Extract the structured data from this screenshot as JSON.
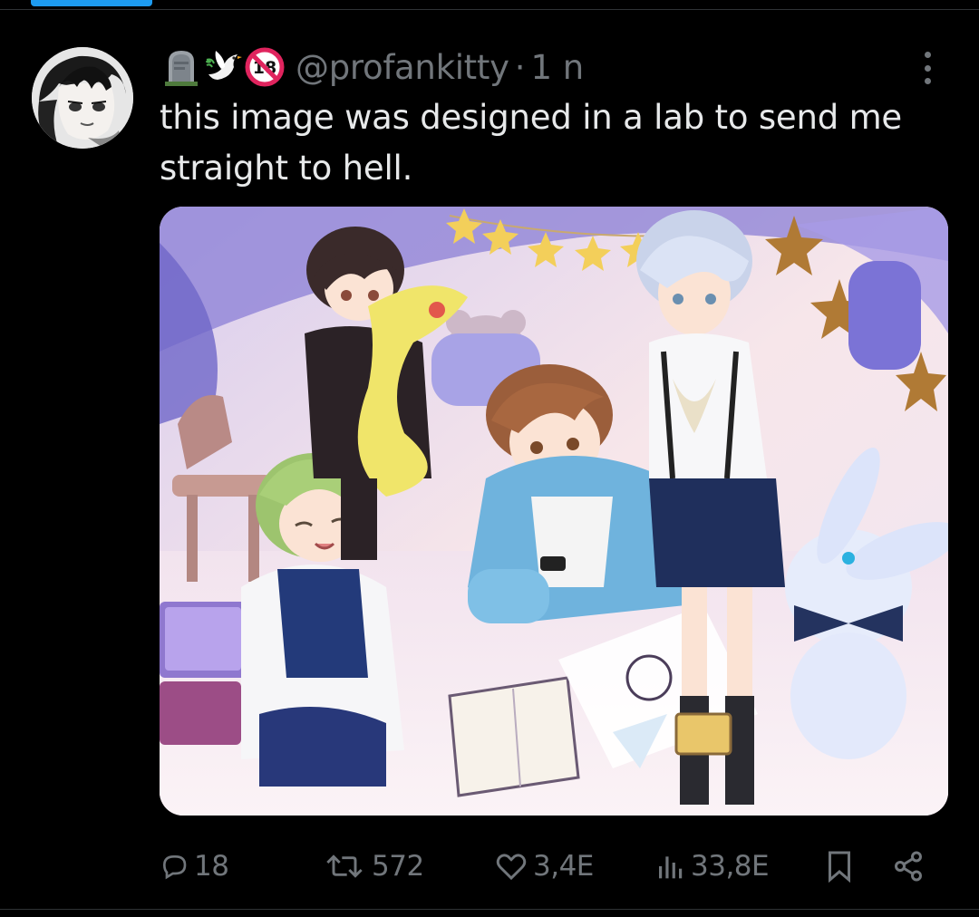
{
  "tweet": {
    "handle": "@profankitty",
    "separator": "·",
    "time": "1 n",
    "text": "this image was designed in a lab to send me straight to hell.",
    "author_emoji": [
      "headstone",
      "dove",
      "no-one-under-eighteen"
    ],
    "no_under_18_badge": "18"
  },
  "actions": {
    "replies": "18",
    "reposts": "572",
    "likes": "3,4E",
    "views": "33,8E"
  },
  "colors": {
    "background": "#000000",
    "text": "#e7e9ea",
    "secondary": "#71767b",
    "accent": "#1d9bf0",
    "border": "#2f3336"
  }
}
